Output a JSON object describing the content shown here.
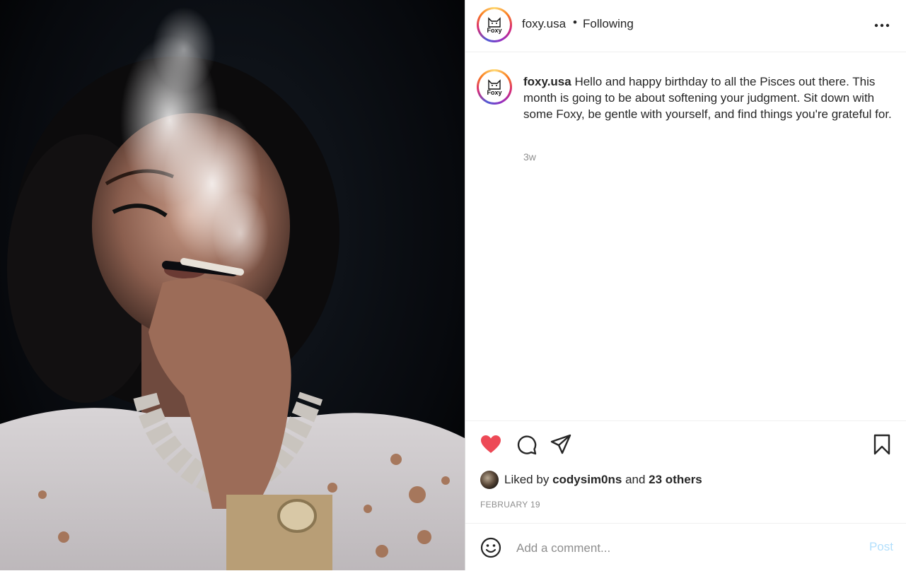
{
  "header": {
    "username": "foxy.usa",
    "separator": "•",
    "follow_status": "Following",
    "logo_text": "Foxy"
  },
  "caption": {
    "username": "foxy.usa",
    "text": "Hello and happy birthday to all the Pisces out there. This month is going to be about softening your judgment. Sit down with some Foxy, be gentle with yourself, and find things you're grateful for.",
    "age": "3w"
  },
  "likes": {
    "prefix": "Liked by",
    "user": "codysim0ns",
    "conjunction": "and",
    "others": "23 others"
  },
  "date": "FEBRUARY 19",
  "comment": {
    "placeholder": "Add a comment...",
    "post_label": "Post"
  },
  "colors": {
    "like_red": "#ed4956",
    "post_blue": "#b2dffc",
    "secondary_text": "#8e8e8e"
  },
  "icons": {
    "like": "heart-filled-icon",
    "comment": "comment-bubble-icon",
    "share": "paper-plane-icon",
    "save": "bookmark-icon",
    "more": "more-horizontal-icon",
    "emoji": "emoji-smile-icon"
  }
}
